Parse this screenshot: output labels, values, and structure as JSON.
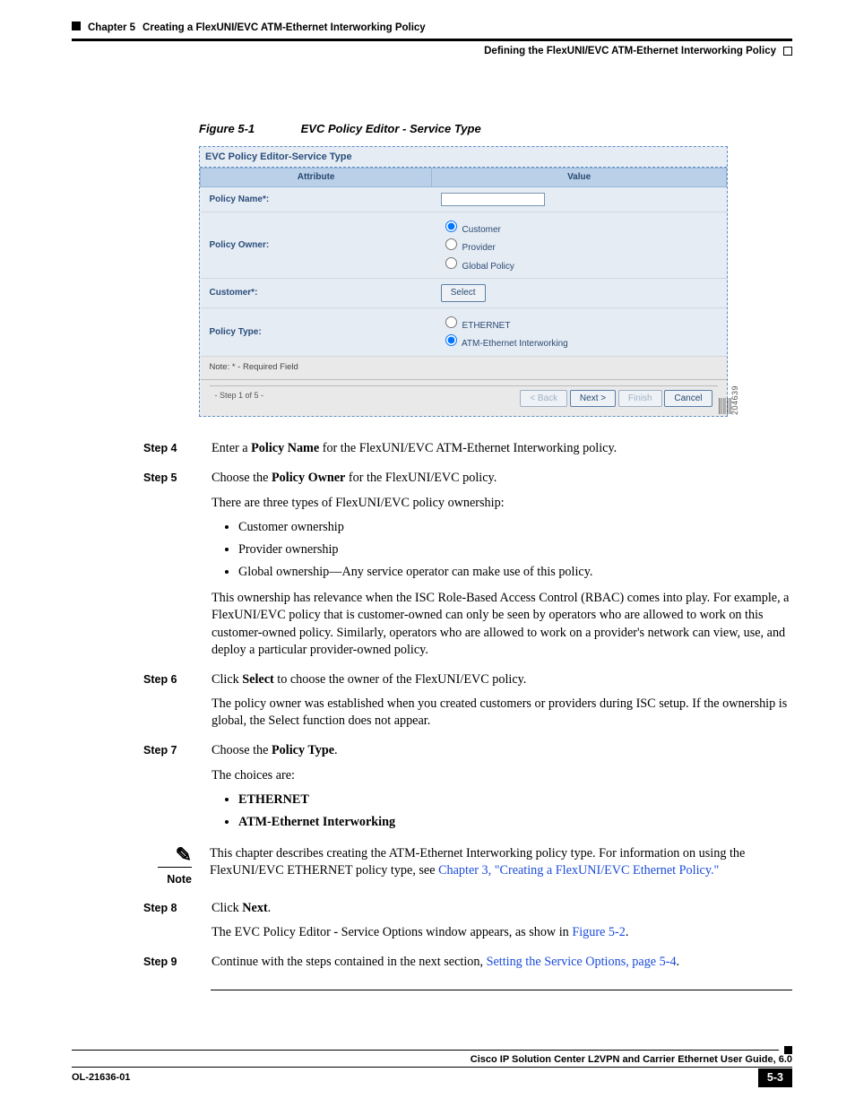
{
  "header": {
    "chapter_label": "Chapter 5",
    "chapter_title": "Creating a FlexUNI/EVC ATM-Ethernet Interworking Policy",
    "section_title": "Defining the FlexUNI/EVC ATM-Ethernet Interworking Policy"
  },
  "figure": {
    "number": "Figure 5-1",
    "title": "EVC Policy Editor - Service Type",
    "side_id": "204639"
  },
  "screenshot": {
    "panel_title": "EVC Policy Editor-Service Type",
    "cols": {
      "attr": "Attribute",
      "val": "Value"
    },
    "rows": {
      "policy_name": {
        "label": "Policy Name*:",
        "value": ""
      },
      "policy_owner": {
        "label": "Policy Owner:",
        "options": [
          "Customer",
          "Provider",
          "Global Policy"
        ],
        "selected": "Customer"
      },
      "customer": {
        "label": "Customer*:",
        "button": "Select"
      },
      "policy_type": {
        "label": "Policy Type:",
        "options": [
          "ETHERNET",
          "ATM-Ethernet Interworking"
        ],
        "selected": "ATM-Ethernet Interworking"
      }
    },
    "note": "Note: * - Required Field",
    "step_info": "- Step 1 of 5 -",
    "buttons": {
      "back": "< Back",
      "next": "Next >",
      "finish": "Finish",
      "cancel": "Cancel"
    }
  },
  "steps": {
    "s4": {
      "label": "Step 4",
      "text_a": "Enter a ",
      "bold_a": "Policy Name",
      "text_b": " for the FlexUNI/EVC ATM-Ethernet Interworking policy."
    },
    "s5": {
      "label": "Step 5",
      "text_a": "Choose the ",
      "bold_a": "Policy Owner",
      "text_b": " for the FlexUNI/EVC policy.",
      "para2": "There are three types of FlexUNI/EVC policy ownership:",
      "bullets": [
        "Customer ownership",
        "Provider ownership",
        "Global ownership—Any service operator can make use of this policy."
      ],
      "para3": "This ownership has relevance when the ISC Role-Based Access Control (RBAC) comes into play. For example, a FlexUNI/EVC policy that is customer-owned can only be seen by operators who are allowed to work on this customer-owned policy. Similarly, operators who are allowed to work on a provider's network can view, use, and deploy a particular provider-owned policy."
    },
    "s6": {
      "label": "Step 6",
      "text_a": "Click ",
      "bold_a": "Select",
      "text_b": " to choose the owner of the FlexUNI/EVC policy.",
      "para2": "The policy owner was established when you created customers or providers during ISC setup. If the ownership is global, the Select function does not appear."
    },
    "s7": {
      "label": "Step 7",
      "text_a": "Choose the ",
      "bold_a": "Policy Type",
      "text_b": ".",
      "para2": "The choices are:",
      "bullets": [
        "ETHERNET",
        "ATM-Ethernet Interworking"
      ]
    },
    "note": {
      "label": "Note",
      "text_a": "This chapter describes creating the ATM-Ethernet Interworking policy type. For information on using the FlexUNI/EVC ETHERNET policy type, see ",
      "link": "Chapter 3, \"Creating a FlexUNI/EVC Ethernet Policy.\""
    },
    "s8": {
      "label": "Step 8",
      "text_a": "Click ",
      "bold_a": "Next",
      "text_b": ".",
      "para2_a": "The EVC Policy Editor - Service Options window appears, as show in ",
      "link": "Figure 5-2",
      "para2_b": "."
    },
    "s9": {
      "label": "Step 9",
      "text_a": "Continue with the steps contained in the next section, ",
      "link": "Setting the Service Options, page 5-4",
      "text_b": "."
    }
  },
  "footer": {
    "book_title": "Cisco IP Solution Center L2VPN and Carrier Ethernet User Guide, 6.0",
    "doc_id": "OL-21636-01",
    "page_num": "5-3"
  }
}
